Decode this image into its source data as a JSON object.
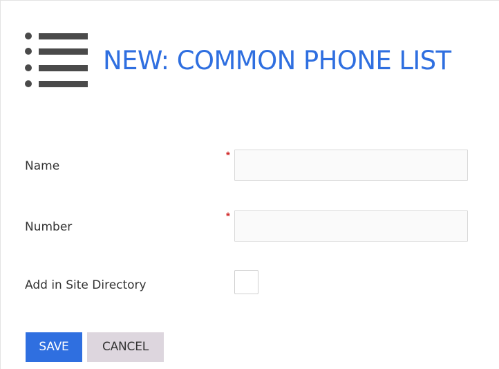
{
  "colors": {
    "title_blue": "#2f6fe0",
    "primary_button_bg": "#2f6fe0",
    "primary_button_text": "#ffffff",
    "secondary_button_bg": "#ddd6de",
    "required_star": "#d02b2b",
    "icon_gray": "#4a4a4a"
  },
  "header": {
    "icon": "list-icon",
    "title": "NEW: COMMON PHONE LIST"
  },
  "form": {
    "fields": [
      {
        "label": "Name",
        "required": true,
        "required_mark": "*",
        "value": ""
      },
      {
        "label": "Number",
        "required": true,
        "required_mark": "*",
        "value": ""
      },
      {
        "label": "Add in Site Directory",
        "type": "checkbox",
        "checked": false
      }
    ]
  },
  "buttons": {
    "save_label": "SAVE",
    "cancel_label": "CANCEL"
  }
}
